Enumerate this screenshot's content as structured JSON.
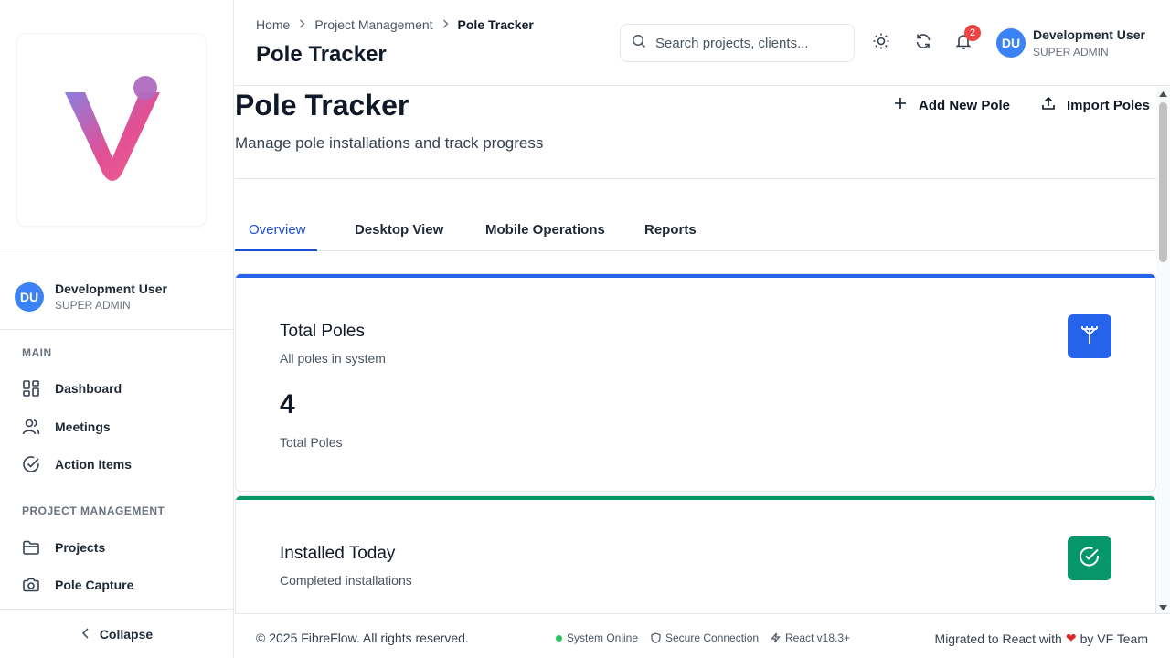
{
  "sidebar": {
    "user": {
      "initials": "DU",
      "name": "Development User",
      "role": "SUPER ADMIN"
    },
    "sections": [
      {
        "title": "MAIN",
        "items": [
          {
            "label": "Dashboard",
            "icon": "dashboard-icon"
          },
          {
            "label": "Meetings",
            "icon": "users-icon"
          },
          {
            "label": "Action Items",
            "icon": "check-circle-icon"
          }
        ]
      },
      {
        "title": "PROJECT MANAGEMENT",
        "items": [
          {
            "label": "Projects",
            "icon": "folder-icon"
          },
          {
            "label": "Pole Capture",
            "icon": "camera-icon"
          }
        ]
      }
    ],
    "collapse_label": "Collapse"
  },
  "header": {
    "breadcrumb": [
      "Home",
      "Project Management",
      "Pole Tracker"
    ],
    "title": "Pole Tracker",
    "search_placeholder": "Search projects, clients...",
    "notification_count": "2",
    "user": {
      "initials": "DU",
      "name": "Development User",
      "role": "SUPER ADMIN"
    }
  },
  "main": {
    "title": "Pole Tracker",
    "subtitle": "Manage pole installations and track progress",
    "actions": {
      "add_label": "Add New Pole",
      "import_label": "Import Poles"
    },
    "tabs": [
      "Overview",
      "Desktop View",
      "Mobile Operations",
      "Reports"
    ],
    "active_tab": "Overview",
    "cards": [
      {
        "title": "Total Poles",
        "subtitle": "All poles in system",
        "value": "4",
        "footer": "Total Poles",
        "accent": "#2563eb",
        "icon": "antenna-icon"
      },
      {
        "title": "Installed Today",
        "subtitle": "Completed installations",
        "accent": "#059669",
        "icon": "check-circle-icon"
      }
    ]
  },
  "footer": {
    "copyright": "© 2025 FibreFlow. All rights reserved.",
    "status_online": "System Online",
    "status_secure": "Secure Connection",
    "status_react": "React v18.3+",
    "credit_prefix": "Migrated to React with",
    "credit_suffix": "by VF Team"
  },
  "colors": {
    "primary": "#2563eb",
    "success": "#059669",
    "danger": "#ef4444",
    "online": "#22c55e"
  }
}
